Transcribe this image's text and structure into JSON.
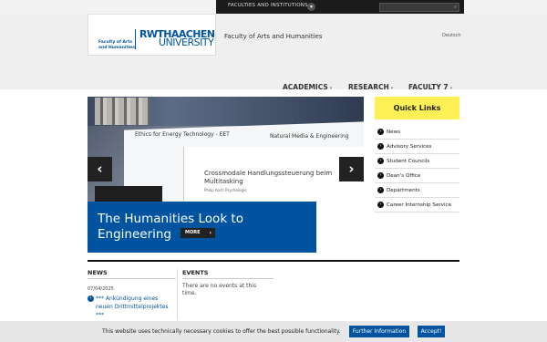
{
  "topbar": {
    "faculties_label": "FACULTIES AND INSTITUTIONS",
    "faculties_toggle_icon": "chevron-down-icon",
    "search_icon": "search-icon",
    "search_placeholder": ""
  },
  "header": {
    "logo_faculty_text": "Faculty of Arts and Humanities",
    "logo_rwth": "RWTHAACHEN",
    "logo_university": "UNIVERSITY",
    "site_title": "Faculty of Arts and Humanities",
    "language_link": "Deutsch"
  },
  "nav": {
    "items": [
      {
        "label": "ACADEMICS"
      },
      {
        "label": "RESEARCH"
      },
      {
        "label": "FACULTY 7"
      }
    ]
  },
  "hero": {
    "image_text_1": "Ethics for Energy Technology - EET",
    "image_text_2": "Natural Media & Engineering",
    "image_text_3": "Crossmodale Handlungssteuerung beim Multitasking",
    "image_text_4": "Philip Koch\nPsychologie",
    "caption_title": "The Humanities Look to Engineering",
    "more_label": "MORE",
    "prev_label": "‹",
    "next_label": "›"
  },
  "quick_links": {
    "title": "Quick Links",
    "items": [
      {
        "label": "News"
      },
      {
        "label": "Advisory Services"
      },
      {
        "label": "Student Councils"
      },
      {
        "label": "Dean's Office"
      },
      {
        "label": "Departments"
      },
      {
        "label": "Career Internship Service"
      }
    ]
  },
  "news": {
    "heading": "NEWS",
    "date": "07/04/2025",
    "item": "*** Ankündigung eines neuen Drittmittelprojektes ***"
  },
  "events": {
    "heading": "EVENTS",
    "empty_text": "There are no events at this time."
  },
  "cookie": {
    "text": "This website uses technically necessary cookies to offer the best possible functionality.",
    "info_button": "Further Information",
    "accept_button": "Accept!"
  },
  "colors": {
    "brand_blue": "#00549f",
    "quick_links_yellow": "#fff055",
    "topbar_dark": "#1b1b1b"
  }
}
